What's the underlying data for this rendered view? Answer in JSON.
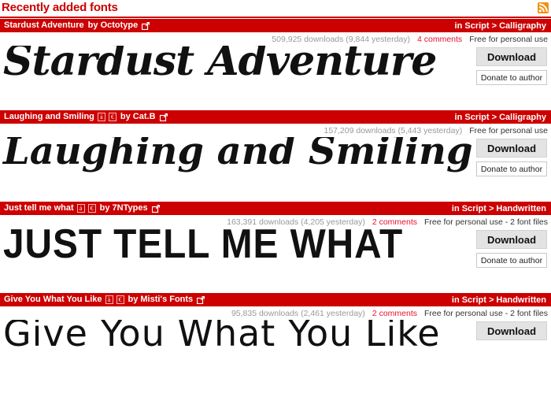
{
  "header": {
    "title": "Recently added fonts",
    "rss_icon": "rss-feed-icon"
  },
  "cards": [
    {
      "name": "Stardust Adventure",
      "by_label": "by Octotype",
      "badges": [],
      "external_link_icon": "external-link-icon",
      "category": "in Script > Calligraphy",
      "downloads": "509,925 downloads (9,844 yesterday)",
      "comments": "4 comments",
      "license": "Free for personal use",
      "preview_text": "Stardust Adventure",
      "preview_style": "script-bold",
      "download_label": "Download",
      "donate_label": "Donate to author",
      "has_donate": true,
      "has_comments": true
    },
    {
      "name": "Laughing and Smiling",
      "by_label": "by Cat.B",
      "badges": [
        "à",
        "€"
      ],
      "external_link_icon": "external-link-icon",
      "category": "in Script > Calligraphy",
      "downloads": "157,209 downloads (5,443 yesterday)",
      "comments": "",
      "license": "Free for personal use",
      "preview_text": "Laughing and Smiling",
      "preview_style": "script-bold-2",
      "download_label": "Download",
      "donate_label": "Donate to author",
      "has_donate": true,
      "has_comments": false
    },
    {
      "name": "Just tell me what",
      "by_label": "by 7NTypes",
      "badges": [
        "à",
        "€"
      ],
      "external_link_icon": "external-link-icon",
      "category": "in Script > Handwritten",
      "downloads": "163,391 downloads (4,205 yesterday)",
      "comments": "2 comments",
      "license": "Free for personal use - 2 font files",
      "preview_text": "JUST TELL ME WHAT",
      "preview_style": "caps-cond",
      "download_label": "Download",
      "donate_label": "Donate to author",
      "has_donate": true,
      "has_comments": true
    },
    {
      "name": "Give You What You Like",
      "by_label": "by Misti's Fonts",
      "badges": [
        "à",
        "€"
      ],
      "external_link_icon": "external-link-icon",
      "category": "in Script > Handwritten",
      "downloads": "95,835 downloads (2,461 yesterday)",
      "comments": "2 comments",
      "license": "Free for personal use - 2 font files",
      "preview_text": "Give You What You Like",
      "preview_style": "thin-hand",
      "download_label": "Download",
      "donate_label": "",
      "has_donate": false,
      "has_comments": true
    }
  ],
  "colors": {
    "brand_red": "#cc0000",
    "comment_red": "#e8112d",
    "rss_orange": "#f2900d",
    "muted_gray": "#999999",
    "button_gray": "#e3e3e3"
  }
}
